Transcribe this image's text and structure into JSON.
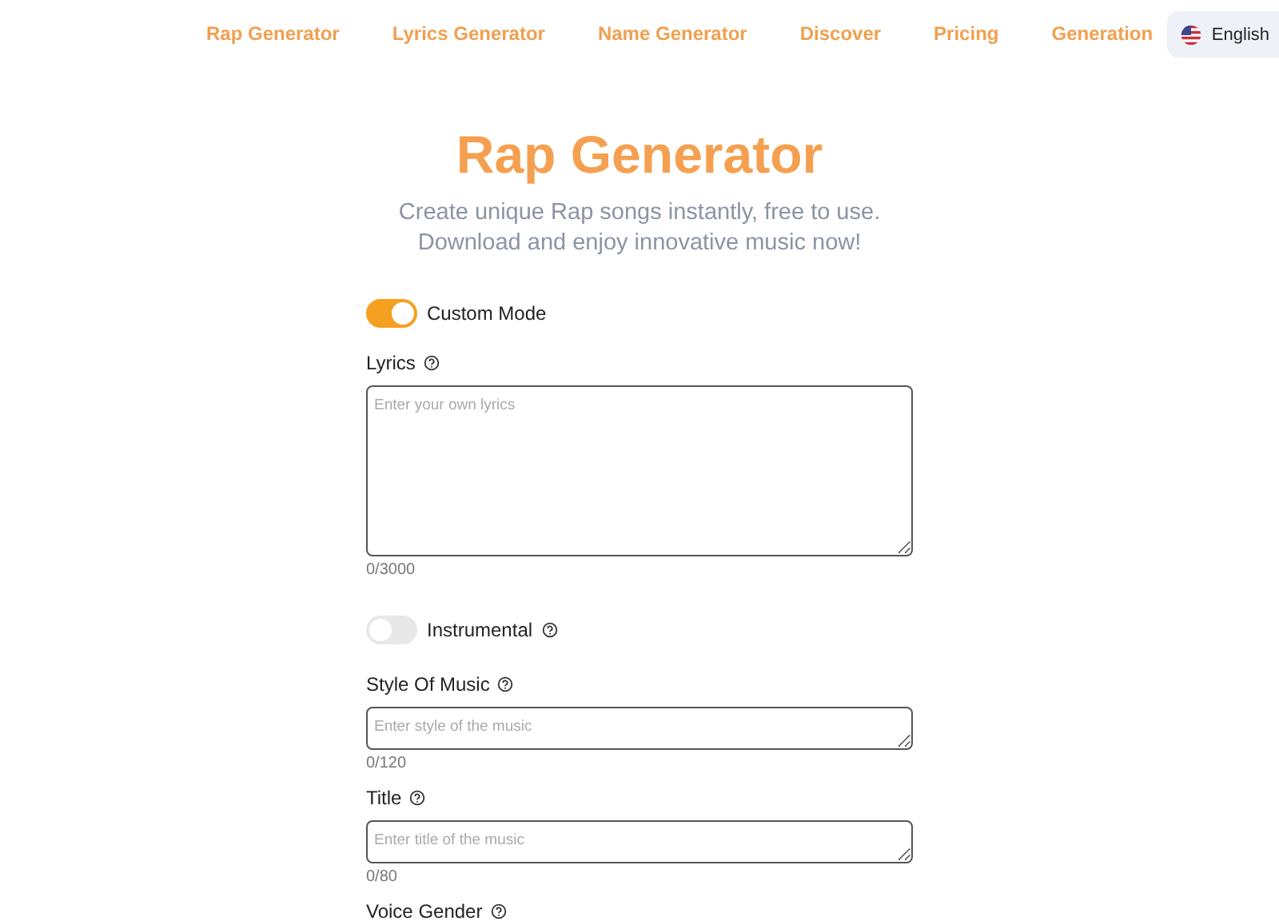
{
  "nav": {
    "links": [
      {
        "label": "Rap Generator"
      },
      {
        "label": "Lyrics Generator"
      },
      {
        "label": "Name Generator"
      },
      {
        "label": "Discover"
      },
      {
        "label": "Pricing"
      },
      {
        "label": "Generation"
      }
    ],
    "language": "English"
  },
  "heading": "Rap Generator",
  "subtitle": [
    "Create unique Rap songs instantly, free to use.",
    "Download and enjoy innovative music now!"
  ],
  "form": [
    {
      "kind": "toggle",
      "label": "Custom Mode",
      "on": true,
      "help": false
    },
    {
      "kind": "textarea",
      "label": "Lyrics",
      "placeholder": "Enter your own lyrics",
      "counter": "0/3000"
    },
    {
      "kind": "toggle",
      "label": "Instrumental",
      "on": false,
      "help": true
    },
    {
      "kind": "field",
      "label": "Style Of Music",
      "placeholder": "Enter style of the music",
      "counter": "0/120"
    },
    {
      "kind": "field",
      "label": "Title",
      "placeholder": "Enter title of the music",
      "counter": "0/80"
    },
    {
      "kind": "label",
      "label": "Voice Gender"
    }
  ]
}
